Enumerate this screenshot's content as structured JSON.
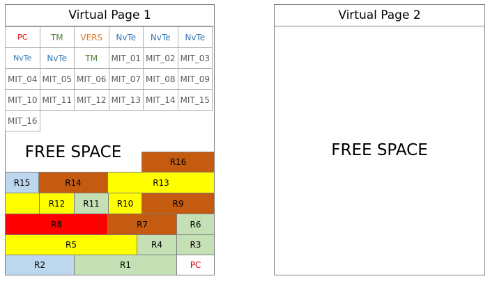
{
  "colors": {
    "red_text": "#e00000",
    "green_text": "#538135",
    "orange_text": "#e07b2a",
    "blue_text": "#2e75b6",
    "gray_text": "#595959",
    "blue_block": "#bdd7ee",
    "brown_block": "#c55a11",
    "yellow_block": "#ffff00",
    "green_block": "#c5e0b4",
    "red_block": "#ff0000",
    "white_block": "#ffffff"
  },
  "page1": {
    "title": "Virtual Page 1",
    "grid": [
      [
        {
          "label": "PC",
          "color": "red"
        },
        {
          "label": "TM",
          "color": "green"
        },
        {
          "label": "VERS",
          "color": "orange"
        },
        {
          "label": "NvTe",
          "color": "blue"
        },
        {
          "label": "NvTe",
          "color": "blue"
        },
        {
          "label": "NvTe",
          "color": "blue"
        }
      ],
      [
        {
          "label": "NvTe",
          "color": "blue"
        },
        {
          "label": "NvTe",
          "color": "blue"
        },
        {
          "label": "TM",
          "color": "green"
        },
        {
          "label": "MIT_01",
          "color": "gray"
        },
        {
          "label": "MIT_02",
          "color": "gray"
        },
        {
          "label": "MIT_03",
          "color": "gray"
        }
      ],
      [
        {
          "label": "MIT_04",
          "color": "gray"
        },
        {
          "label": "MIT_05",
          "color": "gray"
        },
        {
          "label": "MIT_06",
          "color": "gray"
        },
        {
          "label": "MIT_07",
          "color": "gray"
        },
        {
          "label": "MIT_08",
          "color": "gray"
        },
        {
          "label": "MIT_09",
          "color": "gray"
        }
      ],
      [
        {
          "label": "MIT_10",
          "color": "gray"
        },
        {
          "label": "MIT_11",
          "color": "gray"
        },
        {
          "label": "MIT_12",
          "color": "gray"
        },
        {
          "label": "MIT_13",
          "color": "gray"
        },
        {
          "label": "MIT_14",
          "color": "gray"
        },
        {
          "label": "MIT_15",
          "color": "gray"
        }
      ],
      [
        {
          "label": "MIT_16",
          "color": "gray"
        }
      ]
    ],
    "free_space": "FREE SPACE",
    "blocks": {
      "r16": {
        "label": "R16",
        "fill": "brown"
      },
      "r15": {
        "label": "R15",
        "fill": "blue"
      },
      "r14": {
        "label": "R14",
        "fill": "brown"
      },
      "r13": {
        "label": "R13",
        "fill": "yellow"
      },
      "blank": {
        "label": "",
        "fill": "yellow"
      },
      "r12": {
        "label": "R12",
        "fill": "yellow"
      },
      "r11": {
        "label": "R11",
        "fill": "green"
      },
      "r10": {
        "label": "R10",
        "fill": "yellow"
      },
      "r9": {
        "label": "R9",
        "fill": "brown"
      },
      "r8": {
        "label": "R8",
        "fill": "red"
      },
      "r7": {
        "label": "R7",
        "fill": "brown"
      },
      "r6": {
        "label": "R6",
        "fill": "green"
      },
      "r5": {
        "label": "R5",
        "fill": "yellow"
      },
      "r4": {
        "label": "R4",
        "fill": "green"
      },
      "r3": {
        "label": "R3",
        "fill": "green"
      },
      "r2": {
        "label": "R2",
        "fill": "blue"
      },
      "r1": {
        "label": "R1",
        "fill": "green"
      },
      "pc": {
        "label": "PC",
        "fill": "white",
        "text_color": "red"
      }
    }
  },
  "page2": {
    "title": "Virtual Page 2",
    "free_space": "FREE SPACE"
  }
}
